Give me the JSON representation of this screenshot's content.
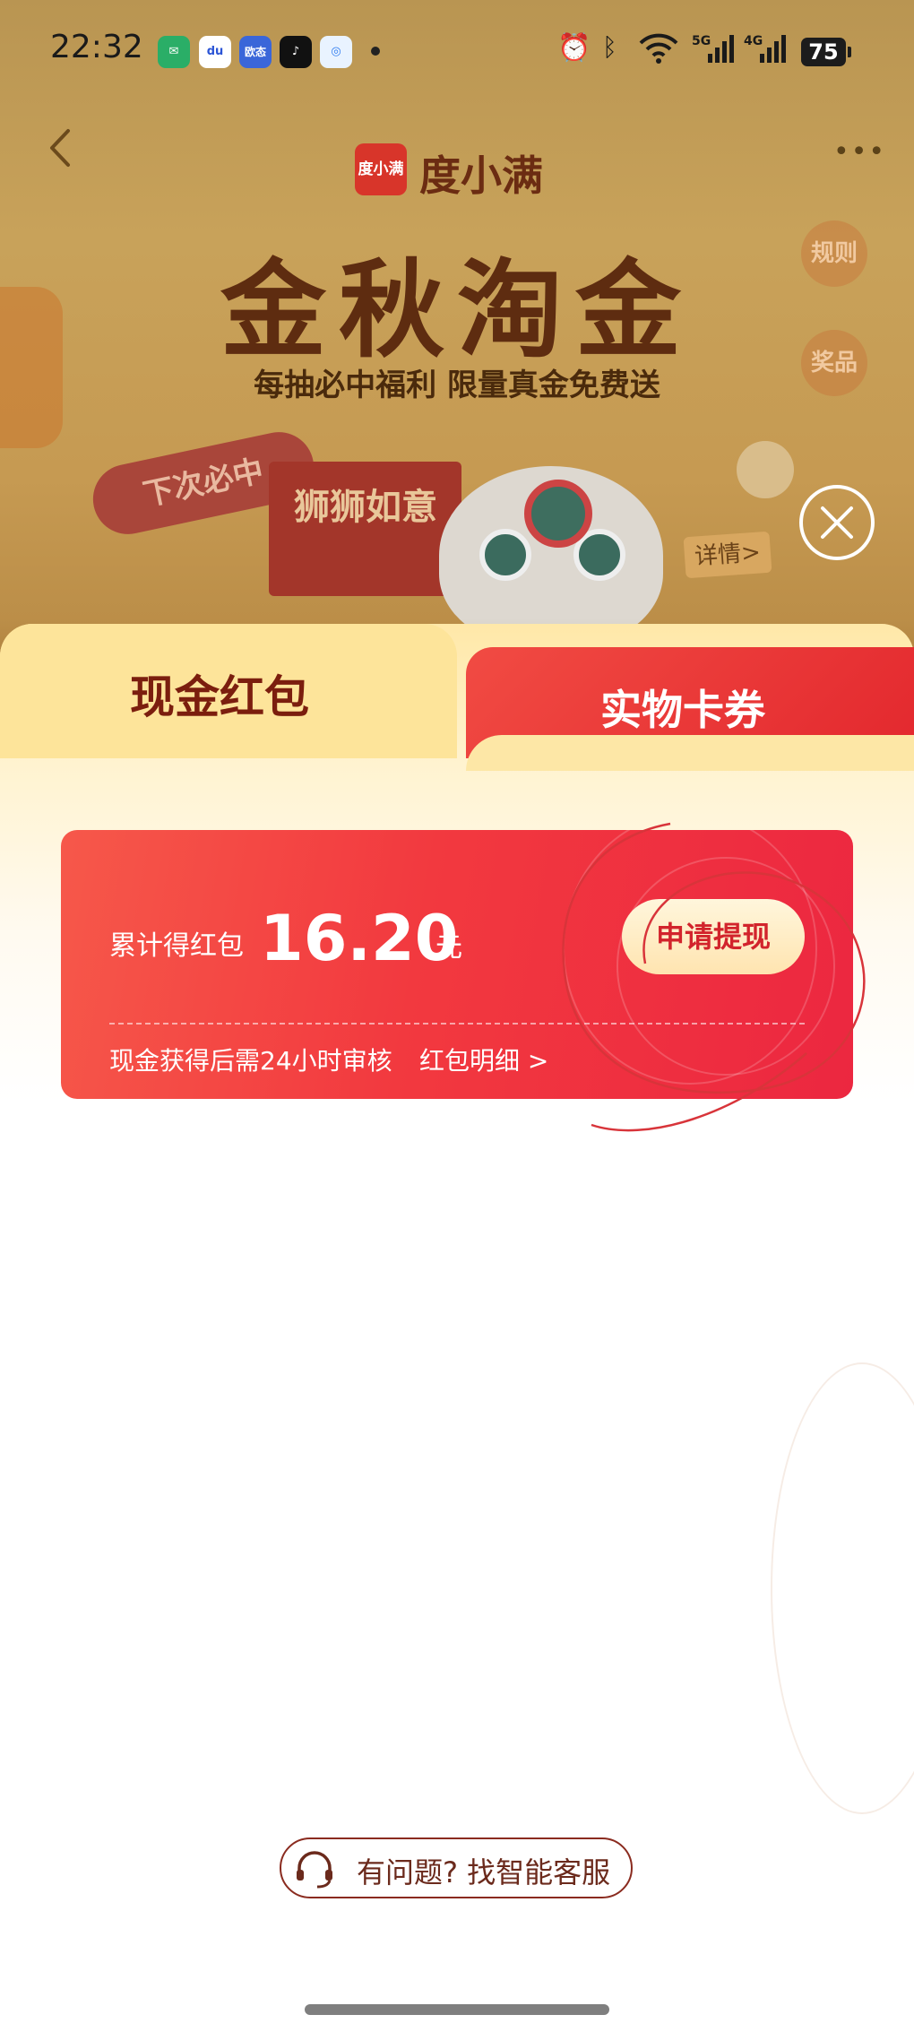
{
  "status_bar": {
    "time": "22:32",
    "apps": [
      "wechat-icon",
      "baidu-icon",
      "oritai-icon",
      "tiktok-icon",
      "browser-icon"
    ],
    "app_label_baidu": "du",
    "app_label_oritai": "欧态",
    "signal_5g": "5G",
    "signal_4g": "4G",
    "battery": "75"
  },
  "header": {
    "logo_badge": "度小满",
    "brand_name": "度小满",
    "title": "金秋淘金",
    "subtitle": "每抽必中福利 限量真金免费送",
    "rules_button": "规则",
    "prizes_button": "奖品",
    "next_tag": "下次必中",
    "gift_text": "狮狮如意",
    "details_link": "详情>"
  },
  "tabs": [
    {
      "label": "现金红包",
      "active": true
    },
    {
      "label": "实物卡券",
      "active": false
    }
  ],
  "card": {
    "cumulative_label": "累计得红包",
    "amount": "16.20",
    "unit": "元",
    "withdraw_button": "申请提现",
    "review_note": "现金获得后需24小时审核",
    "detail_link": "红包明细 >"
  },
  "support": {
    "label": "有问题? 找智能客服"
  },
  "colors": {
    "accent_red": "#f2393f",
    "tab_gold": "#fde49a",
    "banner_gold": "#c8a25a",
    "title_brown": "#5e2c10"
  }
}
